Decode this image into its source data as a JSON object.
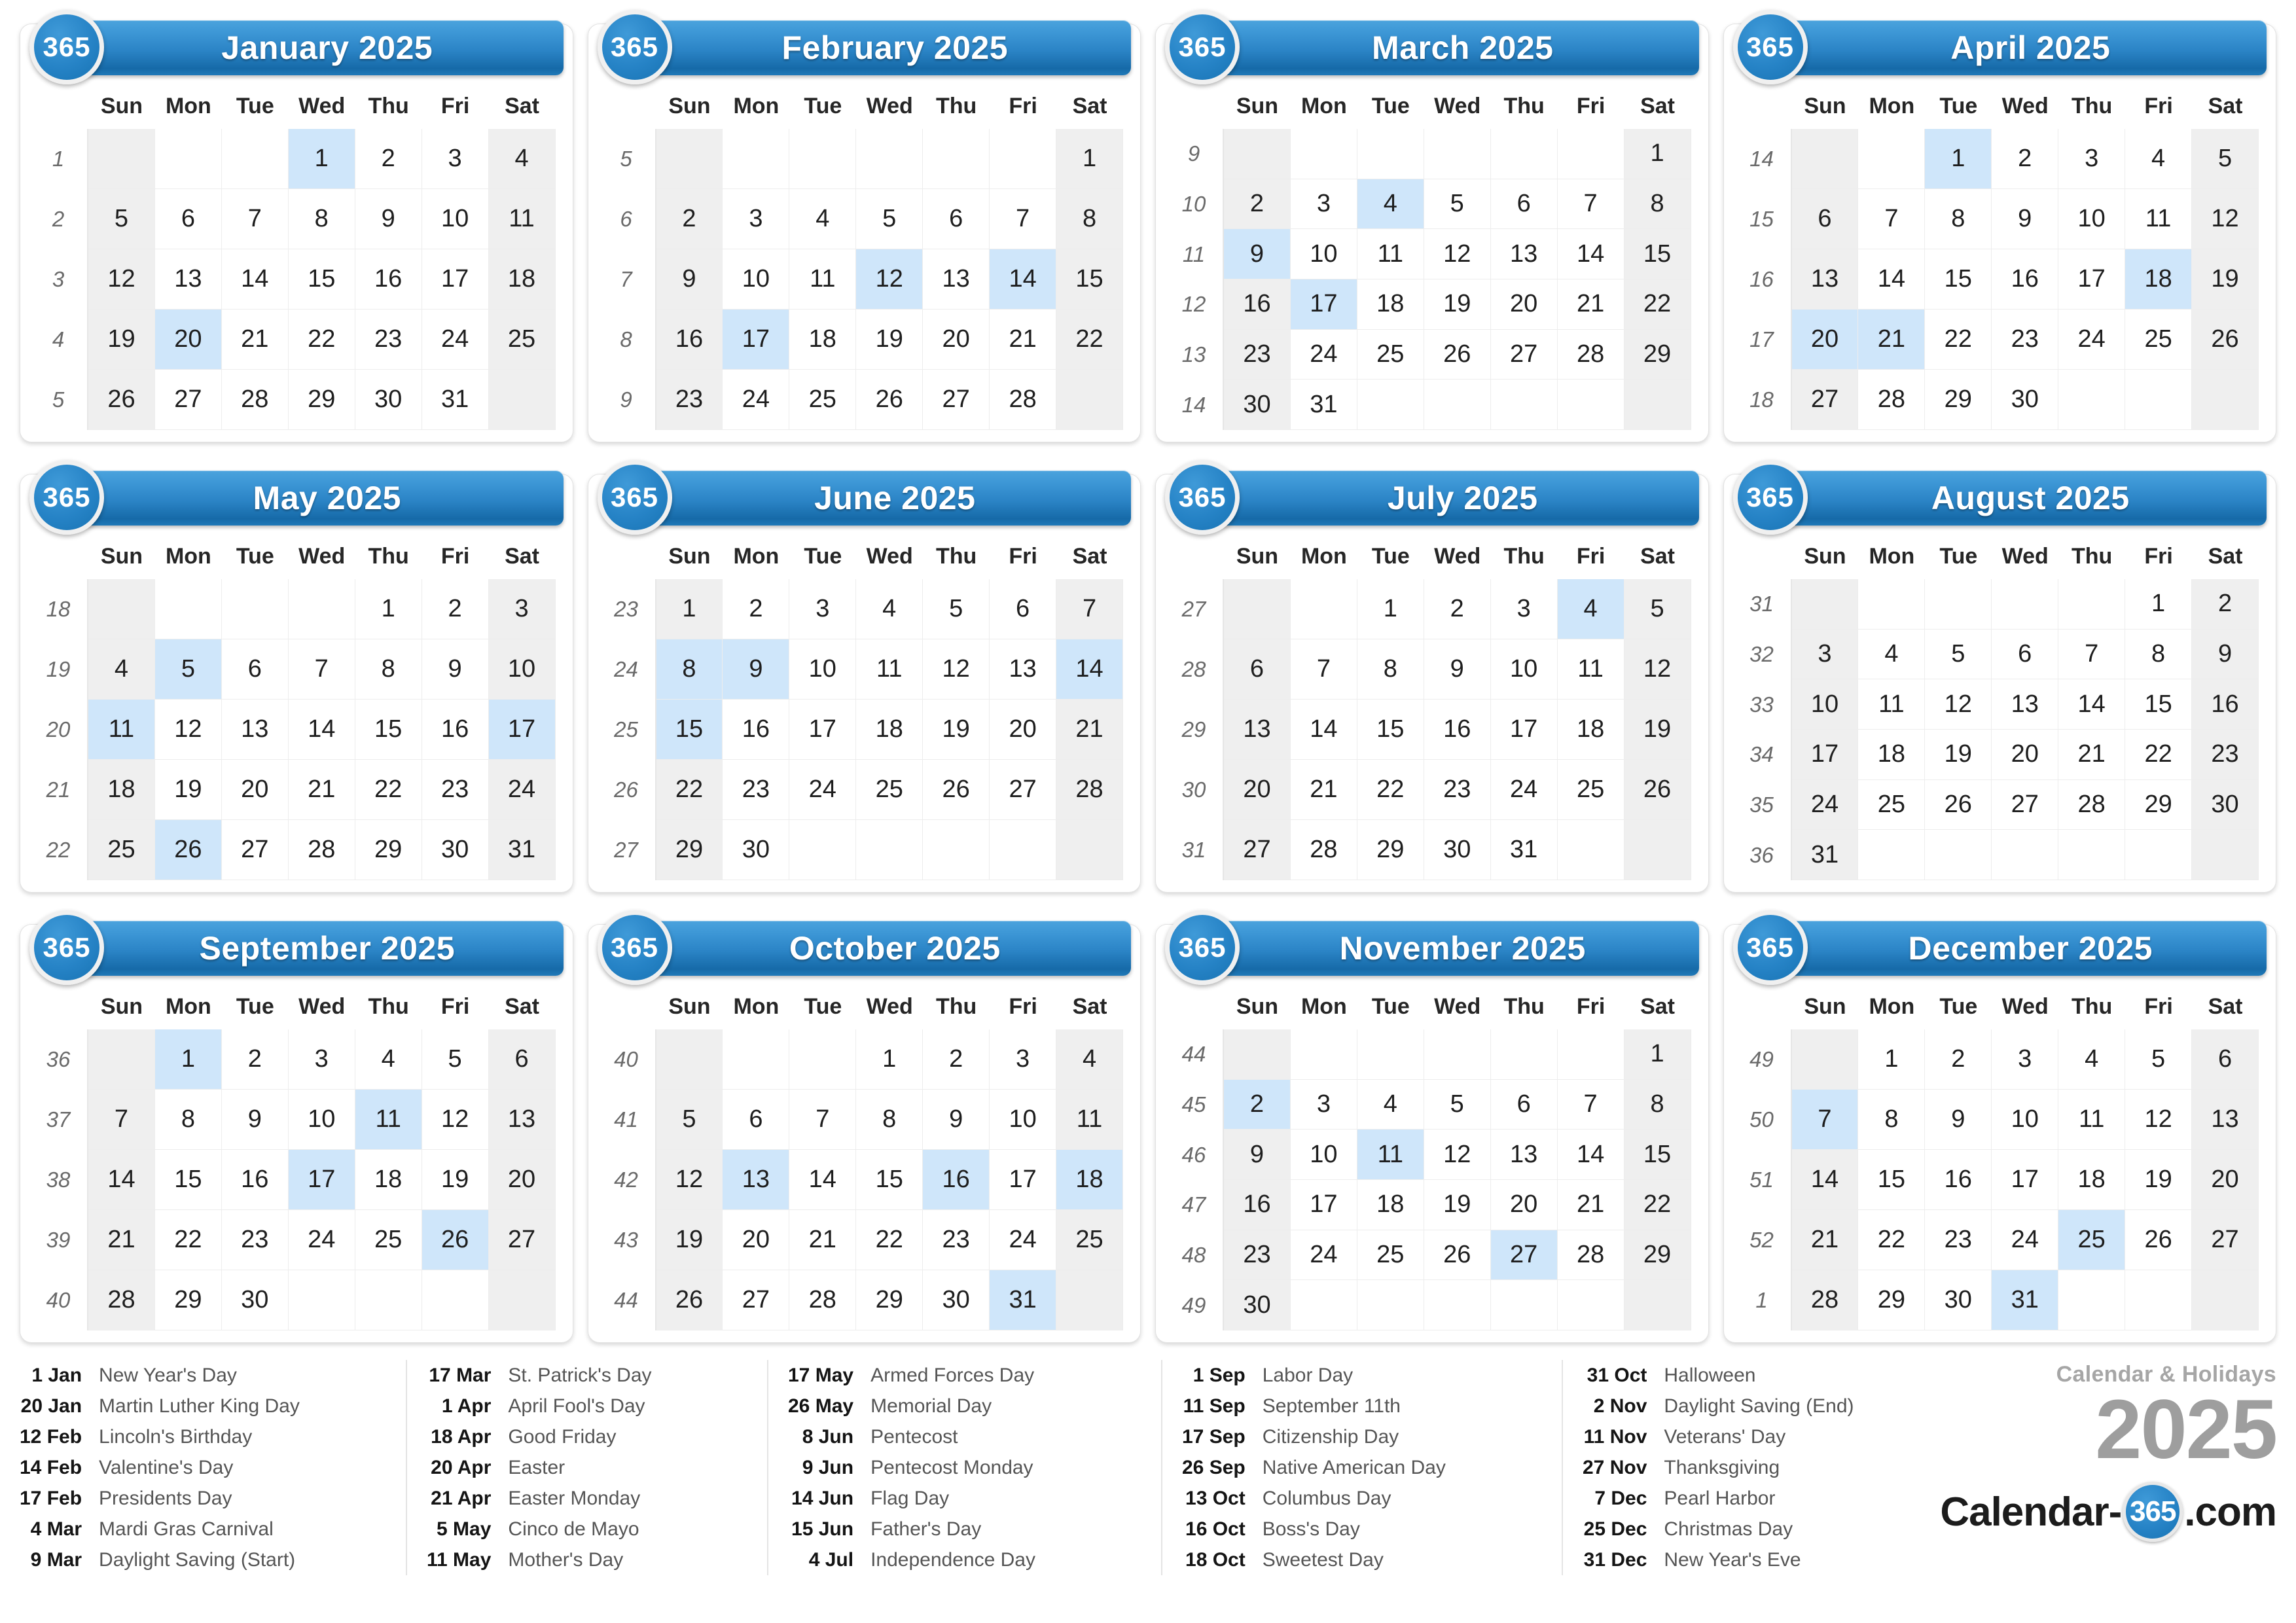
{
  "brand": {
    "badge_text": "365",
    "subtitle": "Calendar & Holidays",
    "year": "2025",
    "logo_prefix": "Calendar-",
    "logo_badge": "365",
    "logo_suffix": ".com"
  },
  "weekdays": [
    "Sun",
    "Mon",
    "Tue",
    "Wed",
    "Thu",
    "Fri",
    "Sat"
  ],
  "months": [
    {
      "title": "January 2025",
      "weeks": [
        "1",
        "2",
        "3",
        "4",
        "5"
      ],
      "rows": [
        [
          "",
          "",
          "",
          "1",
          "2",
          "3",
          "4"
        ],
        [
          "5",
          "6",
          "7",
          "8",
          "9",
          "10",
          "11"
        ],
        [
          "12",
          "13",
          "14",
          "15",
          "16",
          "17",
          "18"
        ],
        [
          "19",
          "20",
          "21",
          "22",
          "23",
          "24",
          "25"
        ],
        [
          "26",
          "27",
          "28",
          "29",
          "30",
          "31",
          ""
        ]
      ],
      "highlights": [
        "1",
        "20"
      ]
    },
    {
      "title": "February 2025",
      "weeks": [
        "5",
        "6",
        "7",
        "8",
        "9"
      ],
      "rows": [
        [
          "",
          "",
          "",
          "",
          "",
          "",
          "1"
        ],
        [
          "2",
          "3",
          "4",
          "5",
          "6",
          "7",
          "8"
        ],
        [
          "9",
          "10",
          "11",
          "12",
          "13",
          "14",
          "15"
        ],
        [
          "16",
          "17",
          "18",
          "19",
          "20",
          "21",
          "22"
        ],
        [
          "23",
          "24",
          "25",
          "26",
          "27",
          "28",
          ""
        ]
      ],
      "highlights": [
        "12",
        "14",
        "17"
      ]
    },
    {
      "title": "March 2025",
      "weeks": [
        "9",
        "10",
        "11",
        "12",
        "13",
        "14"
      ],
      "rows": [
        [
          "",
          "",
          "",
          "",
          "",
          "",
          "1"
        ],
        [
          "2",
          "3",
          "4",
          "5",
          "6",
          "7",
          "8"
        ],
        [
          "9",
          "10",
          "11",
          "12",
          "13",
          "14",
          "15"
        ],
        [
          "16",
          "17",
          "18",
          "19",
          "20",
          "21",
          "22"
        ],
        [
          "23",
          "24",
          "25",
          "26",
          "27",
          "28",
          "29"
        ],
        [
          "30",
          "31",
          "",
          "",
          "",
          "",
          ""
        ]
      ],
      "highlights": [
        "4",
        "9",
        "17"
      ]
    },
    {
      "title": "April 2025",
      "weeks": [
        "14",
        "15",
        "16",
        "17",
        "18"
      ],
      "rows": [
        [
          "",
          "",
          "1",
          "2",
          "3",
          "4",
          "5"
        ],
        [
          "6",
          "7",
          "8",
          "9",
          "10",
          "11",
          "12"
        ],
        [
          "13",
          "14",
          "15",
          "16",
          "17",
          "18",
          "19"
        ],
        [
          "20",
          "21",
          "22",
          "23",
          "24",
          "25",
          "26"
        ],
        [
          "27",
          "28",
          "29",
          "30",
          "",
          "",
          ""
        ]
      ],
      "highlights": [
        "1",
        "18",
        "20",
        "21"
      ]
    },
    {
      "title": "May 2025",
      "weeks": [
        "18",
        "19",
        "20",
        "21",
        "22"
      ],
      "rows": [
        [
          "",
          "",
          "",
          "",
          "1",
          "2",
          "3"
        ],
        [
          "4",
          "5",
          "6",
          "7",
          "8",
          "9",
          "10"
        ],
        [
          "11",
          "12",
          "13",
          "14",
          "15",
          "16",
          "17"
        ],
        [
          "18",
          "19",
          "20",
          "21",
          "22",
          "23",
          "24"
        ],
        [
          "25",
          "26",
          "27",
          "28",
          "29",
          "30",
          "31"
        ]
      ],
      "highlights": [
        "5",
        "11",
        "17",
        "26"
      ]
    },
    {
      "title": "June 2025",
      "weeks": [
        "23",
        "24",
        "25",
        "26",
        "27"
      ],
      "rows": [
        [
          "1",
          "2",
          "3",
          "4",
          "5",
          "6",
          "7"
        ],
        [
          "8",
          "9",
          "10",
          "11",
          "12",
          "13",
          "14"
        ],
        [
          "15",
          "16",
          "17",
          "18",
          "19",
          "20",
          "21"
        ],
        [
          "22",
          "23",
          "24",
          "25",
          "26",
          "27",
          "28"
        ],
        [
          "29",
          "30",
          "",
          "",
          "",
          "",
          ""
        ]
      ],
      "highlights": [
        "8",
        "9",
        "14",
        "15"
      ]
    },
    {
      "title": "July 2025",
      "weeks": [
        "27",
        "28",
        "29",
        "30",
        "31"
      ],
      "rows": [
        [
          "",
          "",
          "1",
          "2",
          "3",
          "4",
          "5"
        ],
        [
          "6",
          "7",
          "8",
          "9",
          "10",
          "11",
          "12"
        ],
        [
          "13",
          "14",
          "15",
          "16",
          "17",
          "18",
          "19"
        ],
        [
          "20",
          "21",
          "22",
          "23",
          "24",
          "25",
          "26"
        ],
        [
          "27",
          "28",
          "29",
          "30",
          "31",
          "",
          ""
        ]
      ],
      "highlights": [
        "4"
      ]
    },
    {
      "title": "August 2025",
      "weeks": [
        "31",
        "32",
        "33",
        "34",
        "35",
        "36"
      ],
      "rows": [
        [
          "",
          "",
          "",
          "",
          "",
          "1",
          "2"
        ],
        [
          "3",
          "4",
          "5",
          "6",
          "7",
          "8",
          "9"
        ],
        [
          "10",
          "11",
          "12",
          "13",
          "14",
          "15",
          "16"
        ],
        [
          "17",
          "18",
          "19",
          "20",
          "21",
          "22",
          "23"
        ],
        [
          "24",
          "25",
          "26",
          "27",
          "28",
          "29",
          "30"
        ],
        [
          "31",
          "",
          "",
          "",
          "",
          "",
          ""
        ]
      ],
      "highlights": []
    },
    {
      "title": "September 2025",
      "weeks": [
        "36",
        "37",
        "38",
        "39",
        "40"
      ],
      "rows": [
        [
          "",
          "1",
          "2",
          "3",
          "4",
          "5",
          "6"
        ],
        [
          "7",
          "8",
          "9",
          "10",
          "11",
          "12",
          "13"
        ],
        [
          "14",
          "15",
          "16",
          "17",
          "18",
          "19",
          "20"
        ],
        [
          "21",
          "22",
          "23",
          "24",
          "25",
          "26",
          "27"
        ],
        [
          "28",
          "29",
          "30",
          "",
          "",
          "",
          ""
        ]
      ],
      "highlights": [
        "1",
        "11",
        "17",
        "26"
      ]
    },
    {
      "title": "October 2025",
      "weeks": [
        "40",
        "41",
        "42",
        "43",
        "44"
      ],
      "rows": [
        [
          "",
          "",
          "",
          "1",
          "2",
          "3",
          "4"
        ],
        [
          "5",
          "6",
          "7",
          "8",
          "9",
          "10",
          "11"
        ],
        [
          "12",
          "13",
          "14",
          "15",
          "16",
          "17",
          "18"
        ],
        [
          "19",
          "20",
          "21",
          "22",
          "23",
          "24",
          "25"
        ],
        [
          "26",
          "27",
          "28",
          "29",
          "30",
          "31",
          ""
        ]
      ],
      "highlights": [
        "13",
        "16",
        "18",
        "31"
      ]
    },
    {
      "title": "November 2025",
      "weeks": [
        "44",
        "45",
        "46",
        "47",
        "48",
        "49"
      ],
      "rows": [
        [
          "",
          "",
          "",
          "",
          "",
          "",
          "1"
        ],
        [
          "2",
          "3",
          "4",
          "5",
          "6",
          "7",
          "8"
        ],
        [
          "9",
          "10",
          "11",
          "12",
          "13",
          "14",
          "15"
        ],
        [
          "16",
          "17",
          "18",
          "19",
          "20",
          "21",
          "22"
        ],
        [
          "23",
          "24",
          "25",
          "26",
          "27",
          "28",
          "29"
        ],
        [
          "30",
          "",
          "",
          "",
          "",
          "",
          ""
        ]
      ],
      "highlights": [
        "2",
        "11",
        "27"
      ]
    },
    {
      "title": "December 2025",
      "weeks": [
        "49",
        "50",
        "51",
        "52",
        "1"
      ],
      "rows": [
        [
          "",
          "1",
          "2",
          "3",
          "4",
          "5",
          "6"
        ],
        [
          "7",
          "8",
          "9",
          "10",
          "11",
          "12",
          "13"
        ],
        [
          "14",
          "15",
          "16",
          "17",
          "18",
          "19",
          "20"
        ],
        [
          "21",
          "22",
          "23",
          "24",
          "25",
          "26",
          "27"
        ],
        [
          "28",
          "29",
          "30",
          "31",
          "",
          "",
          ""
        ]
      ],
      "highlights": [
        "7",
        "25",
        "31"
      ]
    }
  ],
  "holiday_columns": [
    [
      {
        "date": "1 Jan",
        "name": "New Year's Day"
      },
      {
        "date": "20 Jan",
        "name": "Martin Luther King Day"
      },
      {
        "date": "12 Feb",
        "name": "Lincoln's Birthday"
      },
      {
        "date": "14 Feb",
        "name": "Valentine's Day"
      },
      {
        "date": "17 Feb",
        "name": "Presidents Day"
      },
      {
        "date": "4 Mar",
        "name": "Mardi Gras Carnival"
      },
      {
        "date": "9 Mar",
        "name": "Daylight Saving (Start)"
      }
    ],
    [
      {
        "date": "17 Mar",
        "name": "St. Patrick's Day"
      },
      {
        "date": "1 Apr",
        "name": "April Fool's Day"
      },
      {
        "date": "18 Apr",
        "name": "Good Friday"
      },
      {
        "date": "20 Apr",
        "name": "Easter"
      },
      {
        "date": "21 Apr",
        "name": "Easter Monday"
      },
      {
        "date": "5 May",
        "name": "Cinco de Mayo"
      },
      {
        "date": "11 May",
        "name": "Mother's Day"
      }
    ],
    [
      {
        "date": "17 May",
        "name": "Armed Forces Day"
      },
      {
        "date": "26 May",
        "name": "Memorial Day"
      },
      {
        "date": "8 Jun",
        "name": "Pentecost"
      },
      {
        "date": "9 Jun",
        "name": "Pentecost Monday"
      },
      {
        "date": "14 Jun",
        "name": "Flag Day"
      },
      {
        "date": "15 Jun",
        "name": "Father's Day"
      },
      {
        "date": "4 Jul",
        "name": "Independence Day"
      }
    ],
    [
      {
        "date": "1 Sep",
        "name": "Labor Day"
      },
      {
        "date": "11 Sep",
        "name": "September 11th"
      },
      {
        "date": "17 Sep",
        "name": "Citizenship Day"
      },
      {
        "date": "26 Sep",
        "name": "Native American Day"
      },
      {
        "date": "13 Oct",
        "name": "Columbus Day"
      },
      {
        "date": "16 Oct",
        "name": "Boss's Day"
      },
      {
        "date": "18 Oct",
        "name": "Sweetest Day"
      }
    ],
    [
      {
        "date": "31 Oct",
        "name": "Halloween"
      },
      {
        "date": "2 Nov",
        "name": "Daylight Saving (End)"
      },
      {
        "date": "11 Nov",
        "name": "Veterans' Day"
      },
      {
        "date": "27 Nov",
        "name": "Thanksgiving"
      },
      {
        "date": "7 Dec",
        "name": "Pearl Harbor"
      },
      {
        "date": "25 Dec",
        "name": "Christmas Day"
      },
      {
        "date": "31 Dec",
        "name": "New Year's Eve"
      }
    ]
  ],
  "colors": {
    "header_blue": "#2b84c6",
    "highlight_blue": "#cfe6fa",
    "weekend_gray": "#efefef",
    "brand_gray": "#9e9e9e"
  }
}
